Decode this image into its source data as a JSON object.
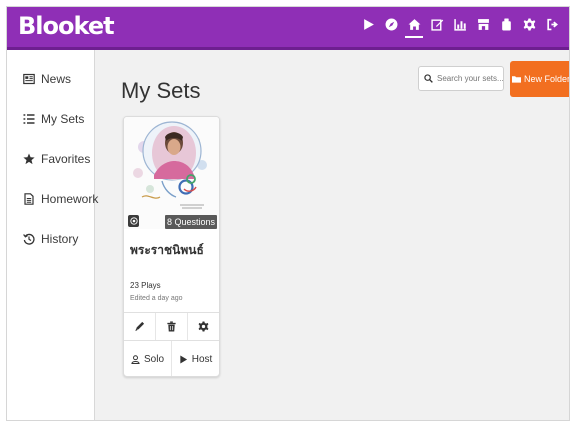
{
  "app": {
    "logo": "Blooket"
  },
  "colors": {
    "brand": "#8f2fb6",
    "accent": "#f26f20"
  },
  "topnav": {
    "icons": [
      "play-icon",
      "compass-icon",
      "home-icon",
      "edit-icon",
      "stats-icon",
      "store-icon",
      "blooks-icon",
      "settings-icon",
      "logout-icon"
    ],
    "active": "home-icon"
  },
  "sidebar": {
    "items": [
      {
        "label": "News",
        "icon": "news-icon"
      },
      {
        "label": "My Sets",
        "icon": "list-icon"
      },
      {
        "label": "Favorites",
        "icon": "star-icon"
      },
      {
        "label": "Homework",
        "icon": "document-icon"
      },
      {
        "label": "History",
        "icon": "history-icon"
      }
    ]
  },
  "main": {
    "title": "My Sets",
    "search": {
      "placeholder": "Search your sets..."
    },
    "new_folder_label": "New Folder"
  },
  "set": {
    "title": "พระราชนิพนธ์",
    "questions": "8 Questions",
    "plays": "23 Plays",
    "edited": "Edited a day ago",
    "solo_label": "Solo",
    "host_label": "Host"
  }
}
